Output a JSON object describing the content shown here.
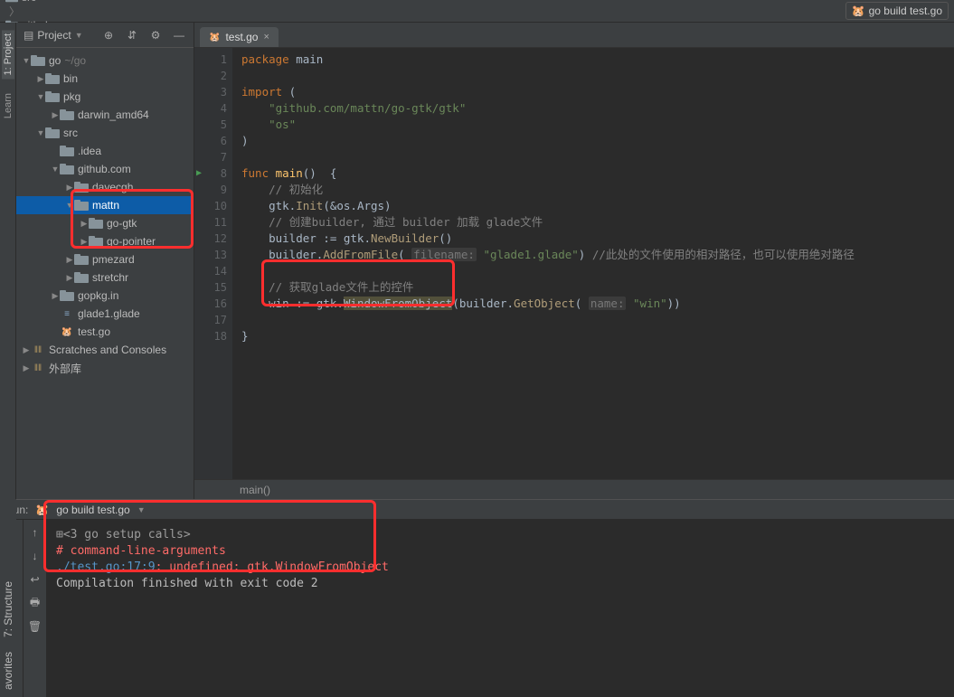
{
  "breadcrumb": [
    "go",
    "src",
    "github.com",
    "mattn"
  ],
  "run_config_label": "go build test.go",
  "side_tabs": {
    "project": "1: Project",
    "learn": "Learn",
    "structure": "7: Structure",
    "favorites": "avorites"
  },
  "project_panel": {
    "title": "Project",
    "tree": [
      {
        "depth": 0,
        "arrow": "down",
        "icon": "folder",
        "label": "go",
        "suffix": "~/go"
      },
      {
        "depth": 1,
        "arrow": "right",
        "icon": "folder",
        "label": "bin"
      },
      {
        "depth": 1,
        "arrow": "down",
        "icon": "folder",
        "label": "pkg"
      },
      {
        "depth": 2,
        "arrow": "right",
        "icon": "folder",
        "label": "darwin_amd64"
      },
      {
        "depth": 1,
        "arrow": "down",
        "icon": "folder",
        "label": "src"
      },
      {
        "depth": 2,
        "arrow": "none",
        "icon": "folder",
        "label": ".idea"
      },
      {
        "depth": 2,
        "arrow": "down",
        "icon": "folder",
        "label": "github.com"
      },
      {
        "depth": 3,
        "arrow": "right",
        "icon": "folder",
        "label": "davecgh"
      },
      {
        "depth": 3,
        "arrow": "down",
        "icon": "folder",
        "label": "mattn",
        "selected": true
      },
      {
        "depth": 4,
        "arrow": "right",
        "icon": "folder",
        "label": "go-gtk"
      },
      {
        "depth": 4,
        "arrow": "right",
        "icon": "folder",
        "label": "go-pointer"
      },
      {
        "depth": 3,
        "arrow": "right",
        "icon": "folder",
        "label": "pmezard"
      },
      {
        "depth": 3,
        "arrow": "right",
        "icon": "folder",
        "label": "stretchr"
      },
      {
        "depth": 2,
        "arrow": "right",
        "icon": "folder",
        "label": "gopkg.in"
      },
      {
        "depth": 2,
        "arrow": "none",
        "icon": "file",
        "label": "glade1.glade"
      },
      {
        "depth": 2,
        "arrow": "none",
        "icon": "gofile",
        "label": "test.go"
      },
      {
        "depth": 0,
        "arrow": "right",
        "icon": "lib",
        "label": "Scratches and Consoles"
      },
      {
        "depth": 0,
        "arrow": "right",
        "icon": "lib",
        "label": "外部库"
      }
    ]
  },
  "editor": {
    "tab": "test.go",
    "lines": [
      {
        "n": 1,
        "html": "<span class='kw'>package</span> main"
      },
      {
        "n": 2,
        "html": ""
      },
      {
        "n": 3,
        "html": "<span class='kw'>import</span> ("
      },
      {
        "n": 4,
        "html": "    <span class='str'>\"github.com/mattn/go-gtk/gtk\"</span>"
      },
      {
        "n": 5,
        "html": "    <span class='str'>\"os\"</span>"
      },
      {
        "n": 6,
        "html": ")"
      },
      {
        "n": 7,
        "html": ""
      },
      {
        "n": 8,
        "html": "<span class='kw'>func</span> <span class='fn'>main</span>()  {",
        "run": true
      },
      {
        "n": 9,
        "html": "    <span class='cmt'>// 初始化</span>"
      },
      {
        "n": 10,
        "html": "    gtk.<span class='fn2'>Init</span>(&amp;os.Args)"
      },
      {
        "n": 11,
        "html": "    <span class='cmt'>// 创建builder, 通过 builder 加载 glade文件</span>"
      },
      {
        "n": 12,
        "html": "    builder := gtk.<span class='fn2'>NewBuilder</span>()"
      },
      {
        "n": 13,
        "html": "    builder.<span class='fn2'>AddFromFile</span>( <span class='hint'>filename:</span> <span class='str'>\"glade1.glade\"</span>) <span class='cmt'>//此处的文件使用的相对路径，也可以使用绝对路径</span>"
      },
      {
        "n": 14,
        "html": ""
      },
      {
        "n": 15,
        "html": "    <span class='cmt'>// 获取glade文件上的控件</span>"
      },
      {
        "n": 16,
        "html": "    win := gtk.<span style='background:#52503a'>WindowFromObject</span>(builder.<span class='fn2'>GetObject</span>( <span class='hint'>name:</span> <span class='str'>\"win\"</span>))"
      },
      {
        "n": 17,
        "html": ""
      },
      {
        "n": 18,
        "html": "}"
      }
    ],
    "breadcrumb_bottom": "main()"
  },
  "run_window": {
    "label": "Run:",
    "config": "go build test.go",
    "lines": [
      {
        "cls": "muted",
        "text": "⊞<3 go setup calls>"
      },
      {
        "cls": "err",
        "text": "# command-line-arguments"
      },
      {
        "cls": "err",
        "html": "<span class='link'>./test.go:17:9</span>: undefined: gtk.WindowFromObject"
      },
      {
        "cls": "",
        "text": ""
      },
      {
        "cls": "",
        "text": "Compilation finished with exit code 2"
      }
    ]
  },
  "colors": {
    "accent": "#0d5ca7",
    "error": "#ff6b68"
  }
}
